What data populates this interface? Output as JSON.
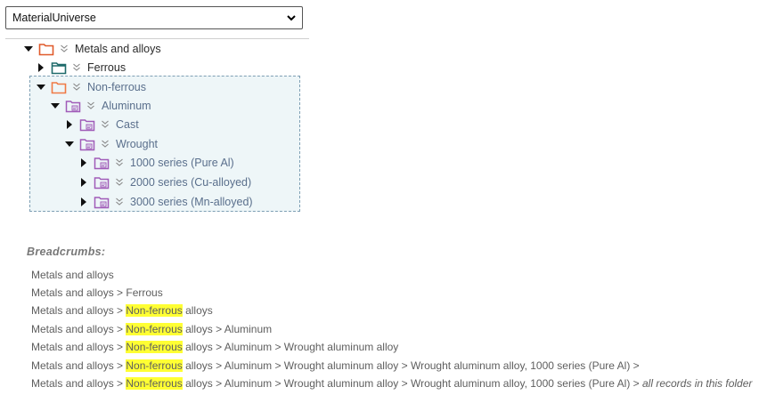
{
  "dropdown": {
    "selected": "MaterialUniverse"
  },
  "tree": {
    "metals": "Metals and alloys",
    "ferrous": "Ferrous",
    "non_ferrous": "Non-ferrous",
    "aluminum": "Aluminum",
    "cast": "Cast",
    "wrought": "Wrought",
    "s1000": "1000 series (Pure Al)",
    "s2000": "2000 series (Cu-alloyed)",
    "s3000": "3000 series (Mn-alloyed)"
  },
  "colors": {
    "folder_red": "#e05a2b",
    "folder_teal": "#1f6b6b",
    "folder_purple": "#a05bb8",
    "highlight": "#ffff33",
    "selection_bg": "#eef6f8"
  },
  "breadcrumbs": {
    "title": "Breadcrumbs:",
    "lines": [
      {
        "pre": "Metals and alloys",
        "hl": "",
        "post": "",
        "tail": ""
      },
      {
        "pre": "Metals and alloys > Ferrous",
        "hl": "",
        "post": "",
        "tail": ""
      },
      {
        "pre": "Metals and alloys > ",
        "hl": "Non-ferrous",
        "post": " alloys",
        "tail": ""
      },
      {
        "pre": "Metals and alloys > ",
        "hl": "Non-ferrous",
        "post": " alloys > Aluminum",
        "tail": ""
      },
      {
        "pre": "Metals and alloys > ",
        "hl": "Non-ferrous",
        "post": " alloys > Aluminum > Wrought aluminum alloy",
        "tail": ""
      },
      {
        "pre": "Metals and alloys > ",
        "hl": "Non-ferrous",
        "post": " alloys > Aluminum > Wrought aluminum alloy > Wrought aluminum alloy, 1000 series (Pure Al) >",
        "tail": ""
      },
      {
        "pre": "Metals and alloys > ",
        "hl": "Non-ferrous",
        "post": " alloys > Aluminum > Wrought aluminum alloy > Wrought aluminum alloy, 1000 series (Pure Al) > ",
        "tail": "all records in this folder"
      }
    ]
  }
}
